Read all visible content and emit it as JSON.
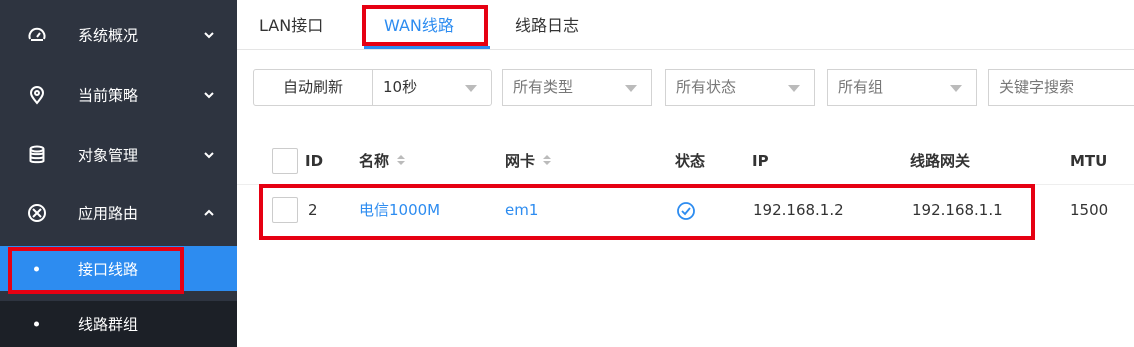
{
  "sidebar": {
    "sections": [
      {
        "label": "系统概况",
        "icon": "dashboard-gauge-icon",
        "expanded": false
      },
      {
        "label": "当前策略",
        "icon": "location-pin-icon",
        "expanded": false
      },
      {
        "label": "对象管理",
        "icon": "database-icon",
        "expanded": false
      },
      {
        "label": "应用路由",
        "icon": "circle-x-icon",
        "expanded": true
      }
    ],
    "sub_items": [
      {
        "label": "接口线路",
        "active": true
      },
      {
        "label": "线路群组",
        "active": false
      }
    ]
  },
  "tabs": [
    {
      "label": "LAN接口",
      "active": false
    },
    {
      "label": "WAN线路",
      "active": true
    },
    {
      "label": "线路日志",
      "active": false
    }
  ],
  "toolbar": {
    "refresh_label": "自动刷新",
    "interval_value": "10秒",
    "type_value": "所有类型",
    "status_value": "所有状态",
    "group_value": "所有组",
    "search_placeholder": "关键字搜索"
  },
  "table": {
    "headers": {
      "id": "ID",
      "name": "名称",
      "nic": "网卡",
      "status": "状态",
      "ip": "IP",
      "gateway": "线路网关",
      "mtu": "MTU"
    },
    "rows": [
      {
        "id": "2",
        "name": "电信1000M",
        "nic": "em1",
        "status": "ok",
        "ip": "192.168.1.2",
        "gateway": "192.168.1.1",
        "mtu": "1500"
      }
    ]
  },
  "colors": {
    "accent": "#2d8cf0",
    "sidebar_bg": "#2e3440",
    "highlight": "#e60012"
  }
}
